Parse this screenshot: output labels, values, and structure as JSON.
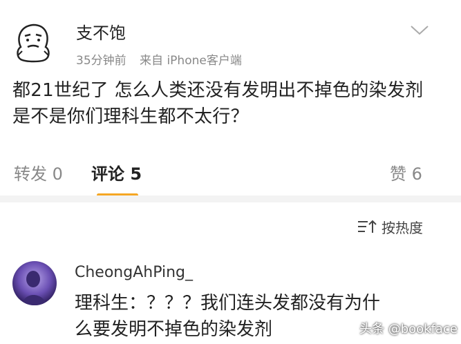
{
  "post": {
    "username": "支不饱",
    "time": "35分钟前",
    "source": "来自 iPhone客户端",
    "text_lines": [
      "都21世纪了 怎么人类还没有发明出不掉色的染发剂",
      "是不是你们理科生都不太行？"
    ],
    "avatar_icon": "cartoon-avatar-icon",
    "menu_icon": "chevron-down-icon"
  },
  "tabs": {
    "repost": "转发 0",
    "comments": "评论 5",
    "likes": "赞 6",
    "accent": "#f5a623"
  },
  "sort": {
    "label": "按热度",
    "icon": "sort-icon"
  },
  "comment": {
    "username": "CheongAhPing_",
    "text_lines": [
      "理科生：？？？我们连头发都没有为什",
      "么要发明不掉色的染发剂"
    ]
  },
  "watermark": "头条 @bookface"
}
